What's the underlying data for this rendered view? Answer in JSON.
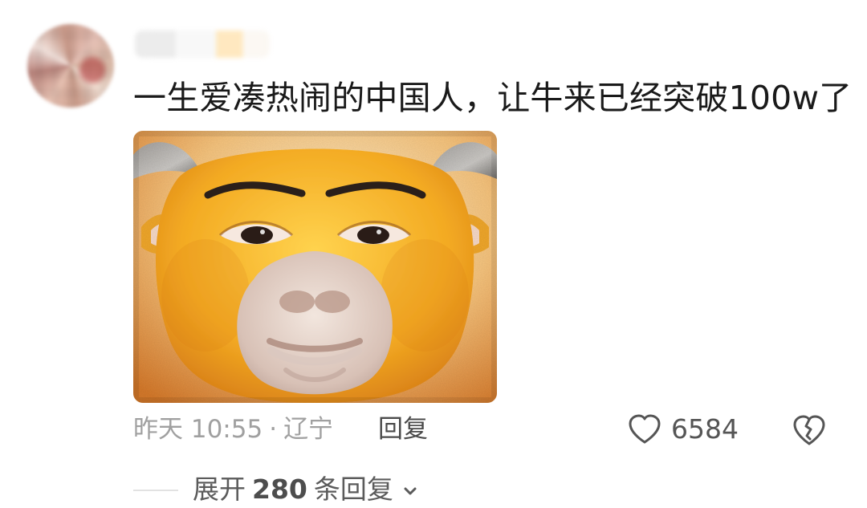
{
  "comment": {
    "text": "一生爱凑热闹的中国人，让牛来已经突破100w了",
    "meta": {
      "time": "昨天 10:55",
      "separator": "·",
      "location": "辽宁"
    },
    "actions": {
      "reply_label": "回复",
      "likes": "6584"
    },
    "replies": {
      "prefix": "展开",
      "count": "280",
      "suffix": "条回复"
    }
  },
  "icons": {
    "like": "heart-outline-icon",
    "dislike": "broken-heart-outline-icon",
    "expand": "chevron-down-icon"
  },
  "colors": {
    "text_primary": "#1a1a1a",
    "text_secondary": "#a0a0a0",
    "action_text": "#4a4a4a",
    "divider": "#e2e2e2"
  }
}
